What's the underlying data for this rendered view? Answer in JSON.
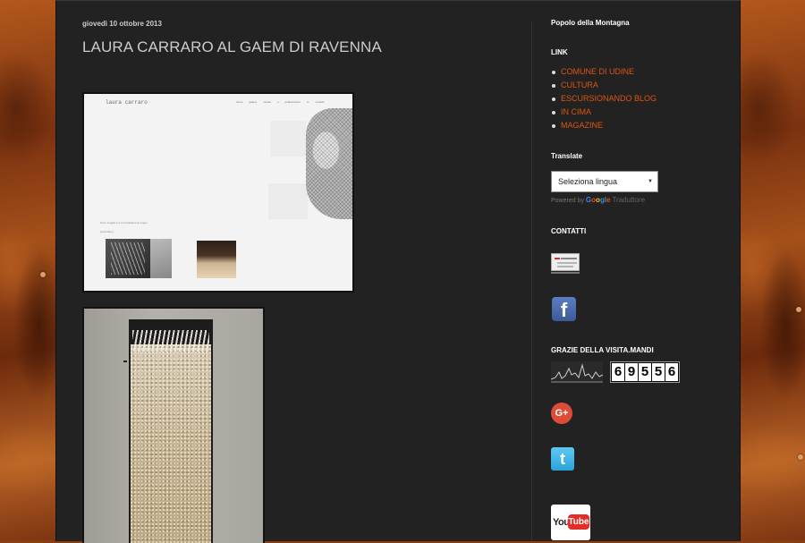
{
  "post": {
    "date": "giovedì 10 ottobre 2013",
    "title": "LAURA CARRARO AL GAEM DI RAVENNA",
    "image1": {
      "brand": "laura carraro",
      "nav": [
        "home",
        "gallery",
        "mostre e pubblicazioni",
        "cv",
        "contatti"
      ],
      "caption": "Sono sveglio è il mio fantasma al sogno.",
      "caption2": "work about"
    }
  },
  "sidebar": {
    "blog_title": "Popolo della Montagna",
    "link_heading": "LINK",
    "links": [
      "COMUNE DI UDINE",
      "CULTURA",
      "ESCURSIONANDO BLOG",
      "IN CIMA",
      "MAGAZINE"
    ],
    "translate_heading": "Translate",
    "translate_select": "Seleziona lingua",
    "powered_by": "Powered by",
    "google_letters": [
      "G",
      "o",
      "o",
      "g",
      "l",
      "e"
    ],
    "translate_brand": "Traduttore",
    "contatti_heading": "CONTATTI",
    "grazie_heading": "GRAZIE DELLA VISITA.MANDI",
    "counter_digits": [
      "6",
      "9",
      "5",
      "5",
      "6"
    ],
    "facebook_glyph": "f",
    "gplus_glyph": "G+",
    "twitter_glyph": "t",
    "youtube_you": "You",
    "youtube_tube": "Tube"
  },
  "colors": {
    "page_bg": "#222222",
    "link": "#dd5511",
    "text": "#cccccc",
    "heading": "#ffffff"
  }
}
